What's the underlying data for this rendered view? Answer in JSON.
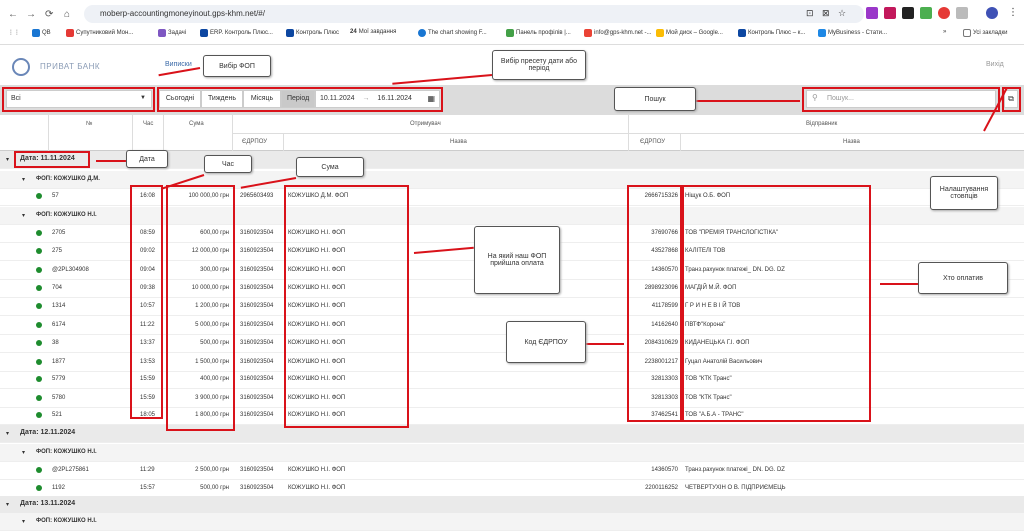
{
  "browser": {
    "url": "moberp-accountingmoneyinout.gps-khm.net/#/",
    "bookmarks": [
      "QB",
      "Супутниковий Мон...",
      "Задачі",
      "ERP. Контроль Плюс...",
      "Контроль Плюс",
      "Мої завдання",
      "The chart showing F...",
      "Панель профілів |...",
      "info@gps-khm.net -...",
      "Мой диск – Google...",
      "Контроль Плюс – к...",
      "MyBusiness - Стати..."
    ],
    "bookmark_badge": "24",
    "all_bookmarks": "Усі закладки"
  },
  "app": {
    "brand": "ПРИВАТ БАНК",
    "nav_link": "Виписки",
    "logout": "Вихід"
  },
  "toolbar": {
    "fop_select": "Всі",
    "presets": [
      "Сьогодні",
      "Тиждень",
      "Місяць",
      "Період"
    ],
    "active_preset": "Період",
    "date_from": "10.11.2024",
    "date_sep": "→",
    "date_to": "16.11.2024",
    "search_placeholder": "Пошук..."
  },
  "table": {
    "headers": {
      "num": "№",
      "time": "Час",
      "sum": "Сума",
      "receiver": "Отримувач",
      "sender": "Відправник",
      "edrpou": "ЄДРПОУ",
      "name": "Назва"
    },
    "rows": [
      {
        "type": "date",
        "label": "Дата: 11.11.2024"
      },
      {
        "type": "fop",
        "label": "ФОП: КОЖУШКО Д.М."
      },
      {
        "type": "tx",
        "num": "57",
        "time": "16:08",
        "sum": "100 000,00 грн",
        "r_code": "2965603493",
        "r_name": "КОЖУШКО Д.М. ФОП",
        "s_code": "2666715326",
        "s_name": "Ніщук О.Б. ФОП"
      },
      {
        "type": "fop",
        "label": "ФОП: КОЖУШКО Н.І."
      },
      {
        "type": "tx",
        "num": "2705",
        "time": "08:59",
        "sum": "600,00 грн",
        "r_code": "3160923504",
        "r_name": "КОЖУШКО Н.І. ФОП",
        "s_code": "37690766",
        "s_name": "ТОВ \"ПРЕМІЯ ТРАНСЛОГІСТІКА\""
      },
      {
        "type": "tx",
        "num": "275",
        "time": "09:02",
        "sum": "12 000,00 грн",
        "r_code": "3160923504",
        "r_name": "КОЖУШКО Н.І. ФОП",
        "s_code": "43527868",
        "s_name": "КАЛІТЕЛІ ТОВ"
      },
      {
        "type": "tx",
        "num": "@2PL304908",
        "time": "09:04",
        "sum": "300,00 грн",
        "r_code": "3160923504",
        "r_name": "КОЖУШКО Н.І. ФОП",
        "s_code": "14360570",
        "s_name": "Транз.рахунок платежі_ DN. DG. DZ"
      },
      {
        "type": "tx",
        "num": "704",
        "time": "09:38",
        "sum": "10 000,00 грн",
        "r_code": "3160923504",
        "r_name": "КОЖУШКО Н.І. ФОП",
        "s_code": "2898923096",
        "s_name": "МАГДІЙ М.Й. ФОП"
      },
      {
        "type": "tx",
        "num": "1314",
        "time": "10:57",
        "sum": "1 200,00 грн",
        "r_code": "3160923504",
        "r_name": "КОЖУШКО Н.І. ФОП",
        "s_code": "41178599",
        "s_name": "Г Р И Н Е В І Й ТОВ"
      },
      {
        "type": "tx",
        "num": "6174",
        "time": "11:22",
        "sum": "5 000,00 грн",
        "r_code": "3160923504",
        "r_name": "КОЖУШКО Н.І. ФОП",
        "s_code": "14162640",
        "s_name": "ПВТФ\"Корона\""
      },
      {
        "type": "tx",
        "num": "38",
        "time": "13:37",
        "sum": "500,00 грн",
        "r_code": "3160923504",
        "r_name": "КОЖУШКО Н.І. ФОП",
        "s_code": "2084310629",
        "s_name": "КИДАНЕЦЬКА Г.І. ФОП"
      },
      {
        "type": "tx",
        "num": "1877",
        "time": "13:53",
        "sum": "1 500,00 грн",
        "r_code": "3160923504",
        "r_name": "КОЖУШКО Н.І. ФОП",
        "s_code": "2238001217",
        "s_name": "Гуцал Анатолій Васильович"
      },
      {
        "type": "tx",
        "num": "5779",
        "time": "15:59",
        "sum": "400,00 грн",
        "r_code": "3160923504",
        "r_name": "КОЖУШКО Н.І. ФОП",
        "s_code": "32813303",
        "s_name": "ТОВ \"КТК Транс\""
      },
      {
        "type": "tx",
        "num": "5780",
        "time": "15:59",
        "sum": "3 900,00 грн",
        "r_code": "3160923504",
        "r_name": "КОЖУШКО Н.І. ФОП",
        "s_code": "32813303",
        "s_name": "ТОВ \"КТК Транс\""
      },
      {
        "type": "tx",
        "num": "521",
        "time": "18:05",
        "sum": "1 800,00 грн",
        "r_code": "3160923504",
        "r_name": "КОЖУШКО Н.І. ФОП",
        "s_code": "37462541",
        "s_name": "ТОВ \"А.Б.А - ТРАНС\""
      },
      {
        "type": "date",
        "label": "Дата: 12.11.2024"
      },
      {
        "type": "fop",
        "label": "ФОП: КОЖУШКО Н.І."
      },
      {
        "type": "tx",
        "num": "@2PL275861",
        "time": "11:29",
        "sum": "2 500,00 грн",
        "r_code": "3160923504",
        "r_name": "КОЖУШКО Н.І. ФОП",
        "s_code": "14360570",
        "s_name": "Транз.рахунок платежі_ DN. DG. DZ"
      },
      {
        "type": "tx",
        "num": "1192",
        "time": "15:57",
        "sum": "500,00 грн",
        "r_code": "3160923504",
        "r_name": "КОЖУШКО Н.І. ФОП",
        "s_code": "2200116252",
        "s_name": "ЧЕТВЕРТУХІН О В. ПІДПРИЄМЕЦЬ"
      },
      {
        "type": "date",
        "label": "Дата: 13.11.2024"
      },
      {
        "type": "fop",
        "label": "ФОП: КОЖУШКО Н.І."
      }
    ]
  },
  "annotations": {
    "fop": "Вибір ФОП",
    "preset": "Вибір пресету дати або період",
    "search": "Пошук",
    "columns": "Налаштування стовпців",
    "date": "Дата",
    "time": "Час",
    "sum": "Сума",
    "receiver": "На який наш ФОП прийшла оплата",
    "payer": "Хто оплатив",
    "edrpou": "Код ЄДРПОУ"
  },
  "colors": {
    "accent_red": "#d9121a",
    "status_green": "#1e8c2e"
  }
}
